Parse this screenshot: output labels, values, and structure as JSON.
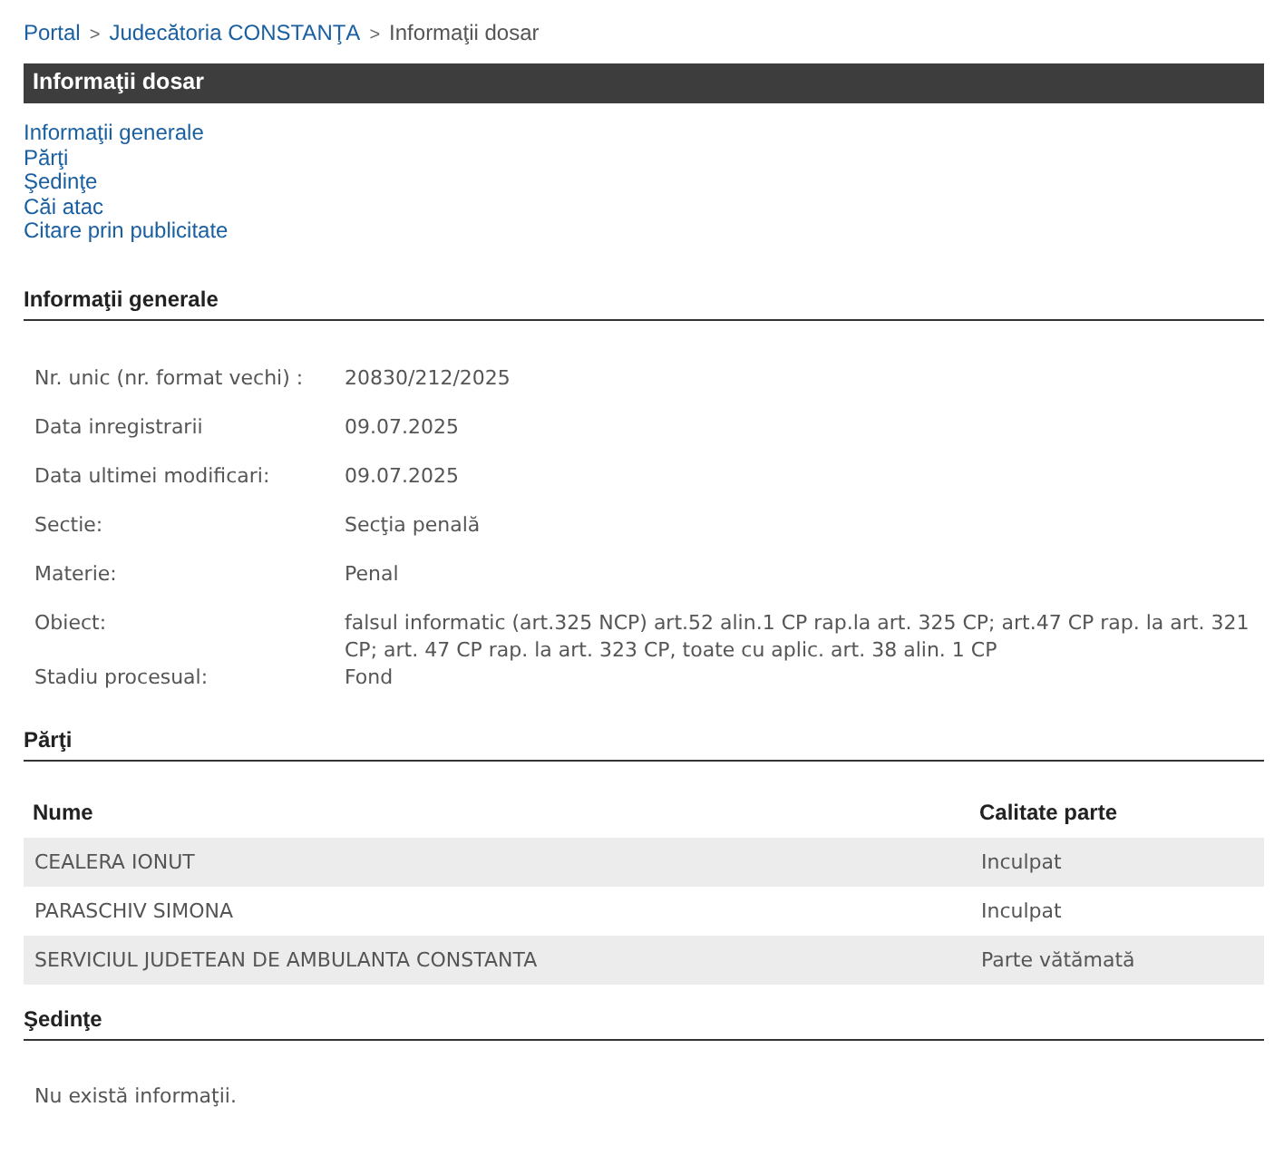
{
  "breadcrumb": [
    {
      "text": "Portal",
      "kind": "link"
    },
    {
      "text": ">",
      "kind": "separator"
    },
    {
      "text": "Judecătoria CONSTANŢA",
      "kind": "link"
    },
    {
      "text": ">",
      "kind": "separator"
    },
    {
      "text": "Informaţii dosar",
      "kind": "current"
    }
  ],
  "title_bar": {
    "title": "Informaţii dosar"
  },
  "nav_links": [
    "Informaţii generale",
    "Părţi",
    "Şedinţe",
    "Căi atac",
    "Citare prin publicitate"
  ],
  "general": {
    "heading": "Informaţii generale",
    "fields": [
      {
        "label": "Nr. unic (nr. format vechi) :",
        "value": "20830/212/2025"
      },
      {
        "label": "Data inregistrarii",
        "value": "09.07.2025"
      },
      {
        "label": "Data ultimei modificari:",
        "value": "09.07.2025"
      },
      {
        "label": "Sectie:",
        "value": "Secţia penală"
      },
      {
        "label": "Materie:",
        "value": "Penal"
      },
      {
        "label": "Obiect:",
        "value": "falsul informatic (art.325 NCP) art.52 alin.1 CP rap.la art. 325 CP; art.47 CP rap. la art. 321 CP; art. 47 CP rap. la art. 323 CP, toate cu aplic. art. 38 alin. 1 CP"
      },
      {
        "label": "Stadiu procesual:",
        "value": "Fond"
      }
    ]
  },
  "parties": {
    "heading": "Părţi",
    "columns": [
      "Nume",
      "Calitate parte"
    ],
    "rows": [
      [
        "CEALERA IONUT",
        "Inculpat"
      ],
      [
        "PARASCHIV SIMONA",
        "Inculpat"
      ],
      [
        "SERVICIUL JUDETEAN DE AMBULANTA CONSTANTA",
        "Parte vătămată"
      ]
    ]
  },
  "hearings": {
    "heading": "Şedinţe",
    "empty_text": "Nu există informaţii."
  }
}
